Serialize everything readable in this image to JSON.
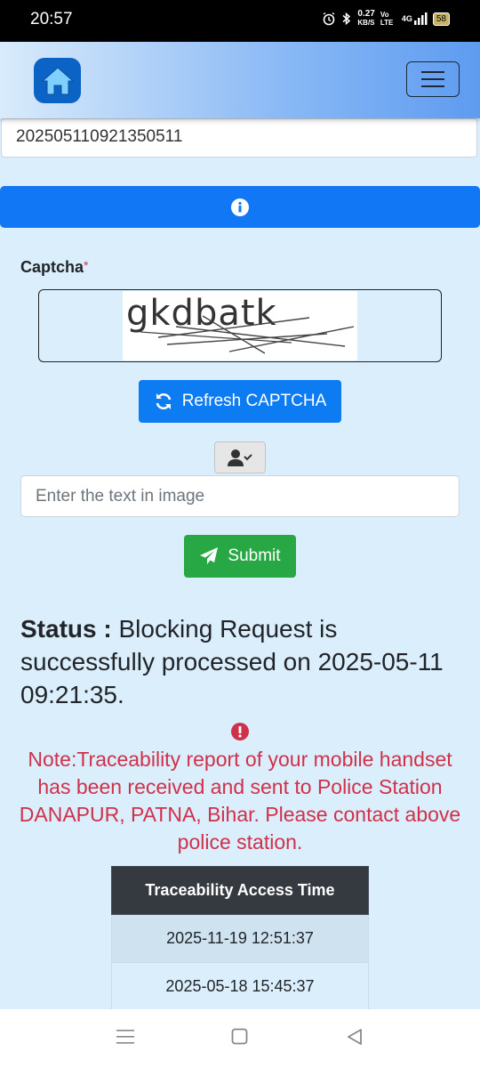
{
  "statusbar": {
    "time": "20:57",
    "speed_value": "0.27",
    "speed_unit": "KB/S",
    "volte": "Vo LTE",
    "network": "4G",
    "battery": "58"
  },
  "header": {
    "logo_icon": "home-icon",
    "menu_icon": "hamburger-menu-icon"
  },
  "form": {
    "reference_value": "202505110921350511",
    "captcha_label": "Captcha",
    "captcha_required_mark": "*",
    "captcha_text": "gkdbatk",
    "refresh_label": "Refresh CAPTCHA",
    "captcha_placeholder": "Enter the text in image",
    "submit_label": "Submit"
  },
  "status": {
    "label": "Status :",
    "text": "Blocking Request is successfully processed on 2025-05-11 09:21:35."
  },
  "note": {
    "text": "Note:Traceability report of your mobile handset has been received and sent to Police Station DANAPUR, PATNA, Bihar. Please contact above police station."
  },
  "trace_table": {
    "header": "Traceability Access Time",
    "rows": [
      "2025-11-19 12:51:37",
      "2025-05-18 15:45:37"
    ]
  },
  "colors": {
    "primary": "#0d7bf2",
    "success": "#28a745",
    "danger": "#d0314a",
    "table_header": "#343a40"
  }
}
